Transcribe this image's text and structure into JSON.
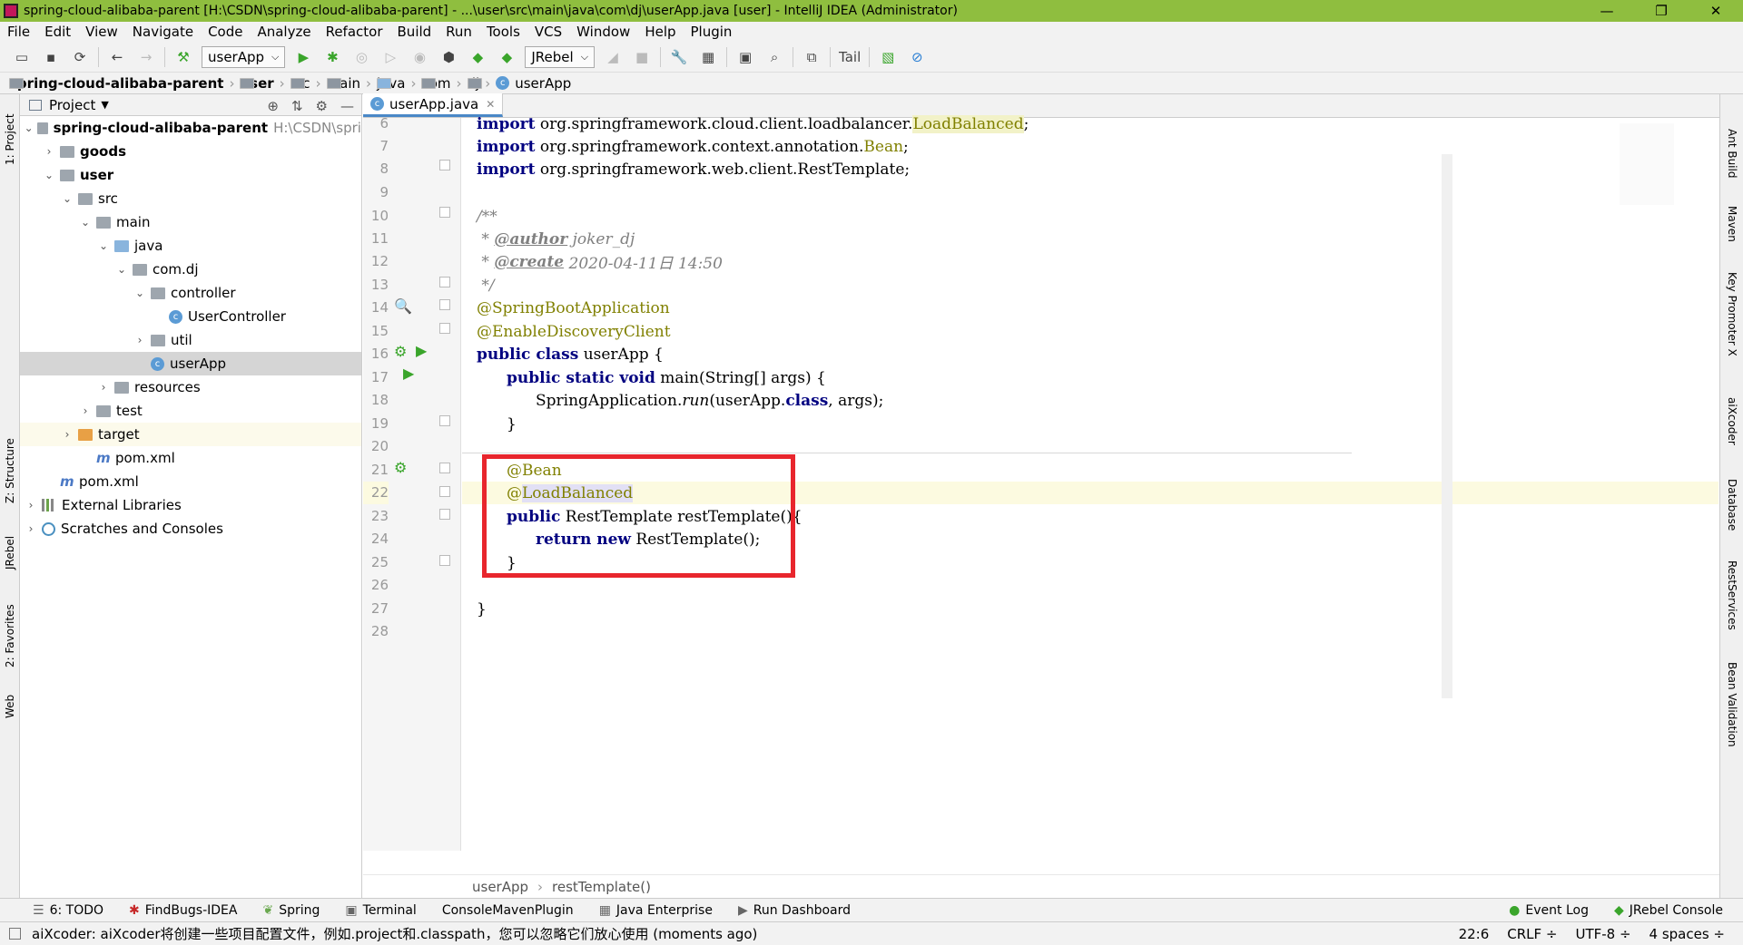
{
  "window": {
    "title": "spring-cloud-alibaba-parent [H:\\CSDN\\spring-cloud-alibaba-parent] - ...\\user\\src\\main\\java\\com\\dj\\userApp.java [user] - IntelliJ IDEA (Administrator)",
    "min": "—",
    "max": "❐",
    "close": "✕"
  },
  "menu": [
    "File",
    "Edit",
    "View",
    "Navigate",
    "Code",
    "Analyze",
    "Refactor",
    "Build",
    "Run",
    "Tools",
    "VCS",
    "Window",
    "Help",
    "Plugin"
  ],
  "toolbar": {
    "run_config": "userApp",
    "jrebel": "JRebel",
    "tail": "Tail"
  },
  "nav": {
    "crumbs": [
      "spring-cloud-alibaba-parent",
      "user",
      "src",
      "main",
      "java",
      "com",
      "dj",
      "userApp"
    ]
  },
  "left_strip": [
    "1: Project",
    "Z: Structure",
    "JRebel",
    "2: Favorites",
    "Web"
  ],
  "right_strip": [
    "Ant Build",
    "Maven",
    "Key Promoter X",
    "aiXcoder",
    "Database",
    "RestServices",
    "Bean Validation"
  ],
  "project": {
    "header": "Project",
    "root": "spring-cloud-alibaba-parent",
    "root_path": "H:\\CSDN\\spri",
    "items": [
      "goods",
      "user",
      "src",
      "main",
      "java",
      "com.dj",
      "controller",
      "UserController",
      "util",
      "userApp",
      "resources",
      "test",
      "target",
      "pom.xml",
      "pom.xml",
      "External Libraries",
      "Scratches and Consoles"
    ]
  },
  "editor": {
    "tab": "userApp.java",
    "line_numbers": [
      "6",
      "7",
      "8",
      "9",
      "10",
      "11",
      "12",
      "13",
      "14",
      "15",
      "16",
      "17",
      "18",
      "19",
      "20",
      "21",
      "22",
      "23",
      "24",
      "25",
      "26",
      "27",
      "28"
    ],
    "code": {
      "l6_kw": "import",
      "l6_rest": " org.springframework.cloud.client.loadbalancer.",
      "l6_ann": "LoadBalanced",
      "l6_end": ";",
      "l7_kw": "import",
      "l7_rest": " org.springframework.context.annotation.",
      "l7_ann": "Bean",
      "l7_end": ";",
      "l8_kw": "import",
      "l8_rest": " org.springframework.web.client.RestTemplate;",
      "l10": "/**",
      "l11_pre": " * ",
      "l11_tag": "@author",
      "l11_val": " joker_dj",
      "l12_pre": " * ",
      "l12_tag": "@create",
      "l12_val": " 2020-04-11日 14:50",
      "l13": " */",
      "l14": "@SpringBootApplication",
      "l15": "@EnableDiscoveryClient",
      "l16_kw": "public class",
      "l16_rest": " userApp {",
      "l17_kw": "public static void",
      "l17_rest": " main(String[] args) {",
      "l18_a": "SpringApplication.",
      "l18_run": "run",
      "l18_b": "(userApp.",
      "l18_kw": "class",
      "l18_c": ", args);",
      "l19": "}",
      "l21": "@Bean",
      "l22_at": "@",
      "l22_name": "LoadBalanced",
      "l23_kw": "public",
      "l23_rest": " RestTemplate restTemplate(){",
      "l24_kw": "return new",
      "l24_rest": " RestTemplate();",
      "l25": "}",
      "l27": "}"
    },
    "breadcrumb": [
      "userApp",
      "restTemplate()"
    ]
  },
  "bottom_tools": [
    "6: TODO",
    "FindBugs-IDEA",
    "Spring",
    "Terminal",
    "ConsoleMavenPlugin",
    "Java Enterprise",
    "Run Dashboard"
  ],
  "bottom_right": [
    "Event Log",
    "JRebel Console"
  ],
  "status": {
    "message": "aiXcoder: aiXcoder将创建一些项目配置文件，例如.project和.classpath，您可以忽略它们放心使用 (moments ago)",
    "position": "22:6",
    "line_sep": "CRLF ÷",
    "encoding": "UTF-8 ÷",
    "indent": "4 spaces ÷"
  },
  "colors": {
    "titlebar": "#8fbe3f",
    "keyword": "#000080",
    "annotation": "#808000",
    "comment": "#808080",
    "highlight_box": "#e8262d"
  }
}
